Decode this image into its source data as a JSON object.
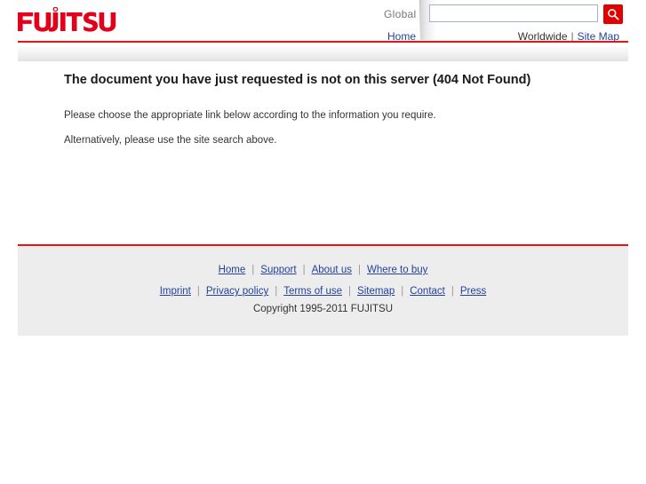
{
  "header": {
    "logo_text": "FUJITSU",
    "logo_color": "#e2001a",
    "region_label": "Global",
    "search": {
      "value": "",
      "placeholder": "",
      "button_icon": "search-icon"
    },
    "home_label": "Home",
    "worldwide_label": "Worldwide",
    "separator": "|",
    "sitemap_label": "Site Map"
  },
  "main": {
    "title": "The document you have just requested is not on this server (404 Not Found)",
    "paragraphs": [
      "Please choose the appropriate link below according to the information you require.",
      "Alternatively, please use the site search above."
    ]
  },
  "footer": {
    "row1": [
      {
        "label": "Home"
      },
      {
        "label": "Support"
      },
      {
        "label": "About us"
      },
      {
        "label": "Where to buy"
      }
    ],
    "row2": [
      {
        "label": "Imprint"
      },
      {
        "label": "Privacy policy"
      },
      {
        "label": "Terms of use"
      },
      {
        "label": "Sitemap"
      },
      {
        "label": "Contact"
      },
      {
        "label": "Press"
      }
    ],
    "separator": "|",
    "copyright": "Copyright 1995-2011 FUJITSU"
  },
  "colors": {
    "brand_red": "#e2001a",
    "rule_red": "#ee1111",
    "link_blue": "#23429c",
    "footer_bg": "#ededed"
  }
}
